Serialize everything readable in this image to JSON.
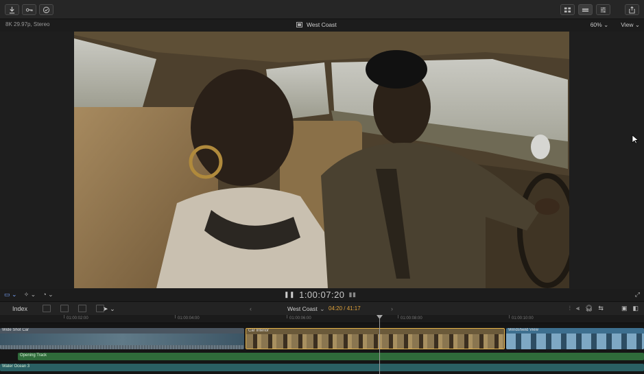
{
  "viewer": {
    "format": "8K 29.97p, Stereo",
    "project": "West Coast",
    "zoom": "60%",
    "view": "View"
  },
  "controls": {
    "timecode": "1:00:07:20"
  },
  "timeline": {
    "index_label": "Index",
    "title": "West Coast",
    "duration": "04:20 / 41:17",
    "ruler": [
      "01:00:02:00",
      "01:00:04:00",
      "01:00:06:00",
      "01:00:08:00",
      "01:00:10:00"
    ],
    "clips": {
      "wide": "Wide Shot Car",
      "interior": "Car Interior",
      "windshield": "Windshield View"
    },
    "audio": {
      "music": "Opening Track",
      "ambience": "Water Ocean 3"
    }
  },
  "colors": {
    "selection": "#e3b24a",
    "music": "#2f6b3a",
    "ambience": "#2a5f63",
    "accent": "#7aa6ff"
  }
}
